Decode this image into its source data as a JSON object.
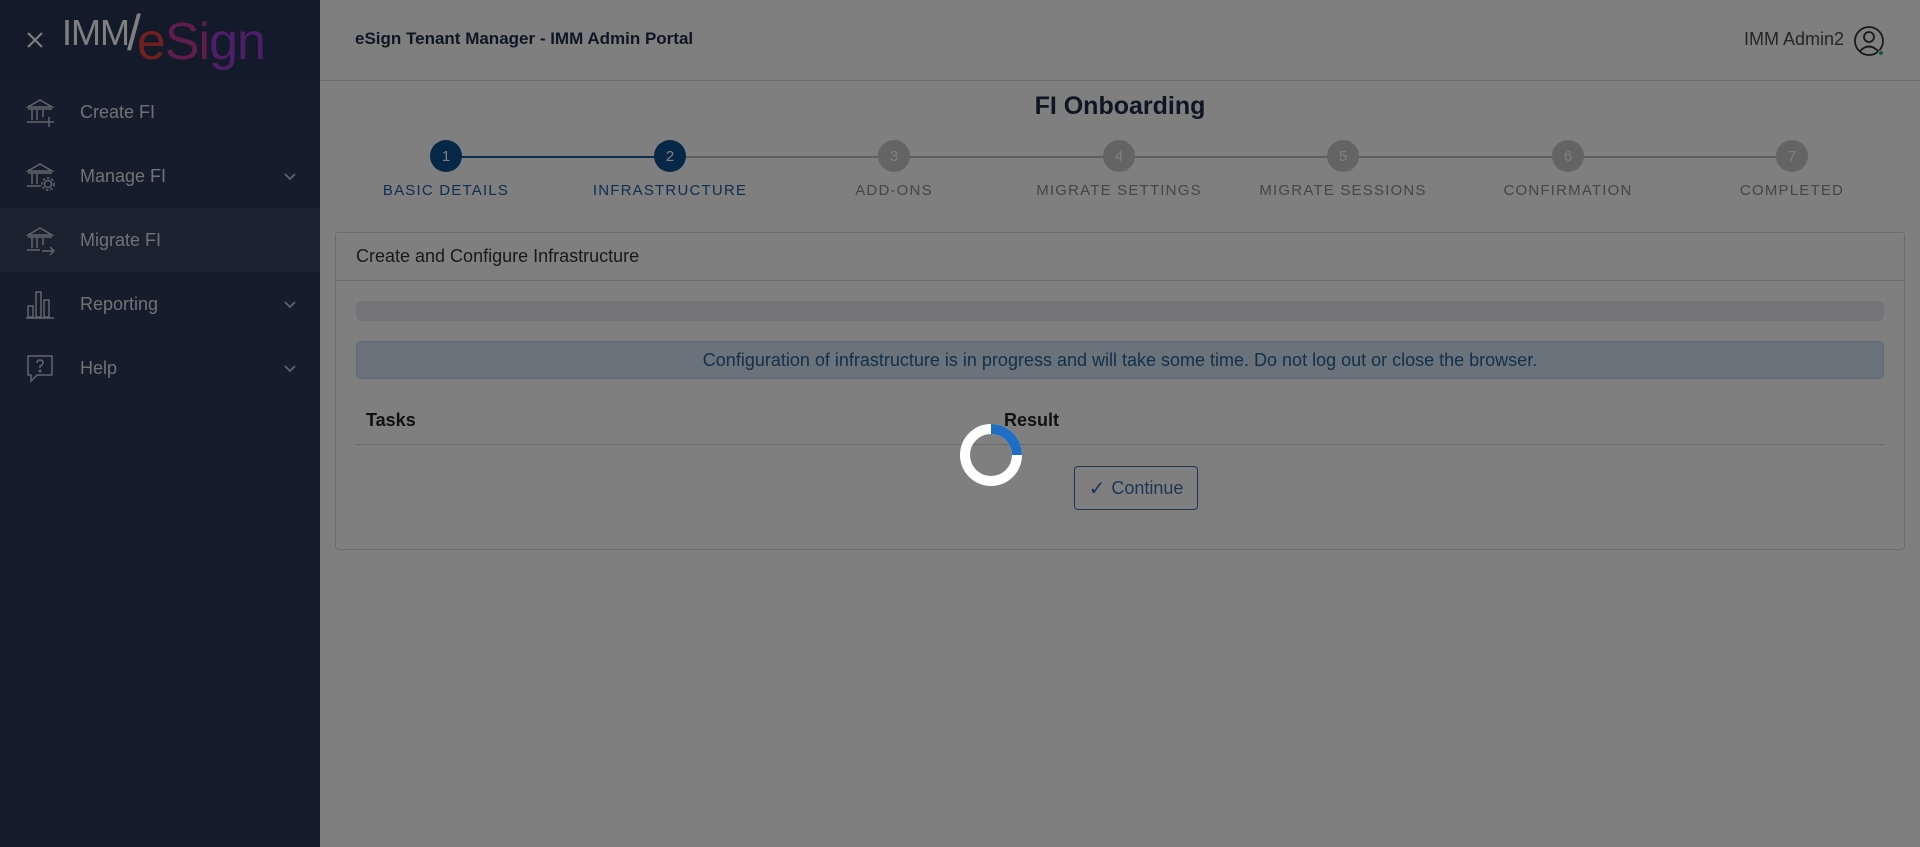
{
  "sidebar": {
    "logo": {
      "imm": "IMM",
      "esign_e": "e",
      "esign_si": "Si",
      "esign_gn": "gn"
    },
    "items": [
      {
        "label": "Create FI",
        "icon": "bank-plus-icon"
      },
      {
        "label": "Manage FI",
        "icon": "bank-gear-icon"
      },
      {
        "label": "Migrate FI",
        "icon": "bank-arrow-icon"
      },
      {
        "label": "Reporting",
        "icon": "bar-chart-icon"
      },
      {
        "label": "Help",
        "icon": "help-bubble-icon"
      }
    ]
  },
  "topbar": {
    "title": "eSign Tenant Manager - IMM Admin Portal",
    "user": "IMM Admin2"
  },
  "page": {
    "title": "FI Onboarding"
  },
  "stepper": {
    "current_step": 2,
    "steps": [
      {
        "number": "1",
        "label": "BASIC DETAILS"
      },
      {
        "number": "2",
        "label": "INFRASTRUCTURE"
      },
      {
        "number": "3",
        "label": "ADD-ONS"
      },
      {
        "number": "4",
        "label": "MIGRATE SETTINGS"
      },
      {
        "number": "5",
        "label": "MIGRATE SESSIONS"
      },
      {
        "number": "6",
        "label": "CONFIRMATION"
      },
      {
        "number": "7",
        "label": "COMPLETED"
      }
    ]
  },
  "card": {
    "header": "Create and Configure Infrastructure",
    "progress": 0,
    "alert": "Configuration of infrastructure is in progress and will take some time. Do not log out or close the browser.",
    "table_headers": {
      "tasks": "Tasks",
      "result": "Result"
    },
    "continue_label": "Continue",
    "continue_icon": "✓"
  },
  "colors": {
    "sidebar_bg": "#2b3a58",
    "primary": "#0f4f8f",
    "alert_bg": "#d4e6f7",
    "spinner_accent": "#1e6fc4"
  }
}
